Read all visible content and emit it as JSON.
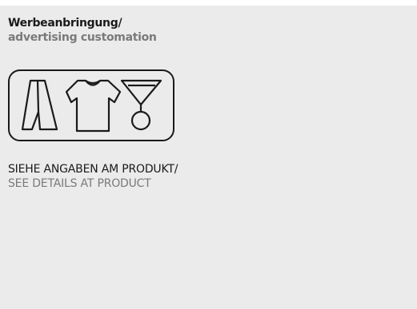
{
  "heading": {
    "title_de": "Werbeanbringung/",
    "title_en": "advertising customation"
  },
  "icons": [
    "scarf-icon",
    "tshirt-icon",
    "lanyard-medal-icon"
  ],
  "details": {
    "line_de": "SIEHE ANGABEN AM PRODUKT/",
    "line_en": "SEE DETAILS AT PRODUCT"
  }
}
